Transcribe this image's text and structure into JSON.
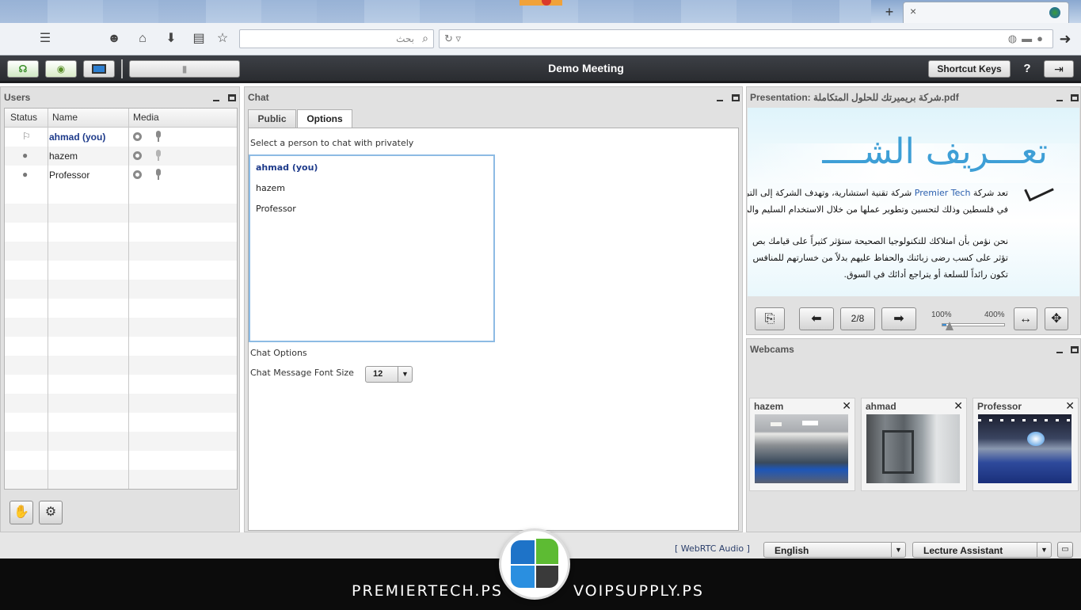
{
  "browser": {
    "new_tab_label": "+",
    "close_tab_label": "×",
    "search_placeholder": "بحث"
  },
  "toolbar": {
    "meeting_title": "Demo Meeting",
    "shortcut_keys_label": "Shortcut Keys",
    "help_label": "?"
  },
  "users_panel": {
    "title": "Users",
    "columns": [
      "Status",
      "Name",
      "Media"
    ],
    "users": [
      {
        "name": "ahmad (you)",
        "is_self": true,
        "role": "presenter",
        "mic_muted": false
      },
      {
        "name": "hazem",
        "is_self": false,
        "role": "viewer",
        "mic_muted": true
      },
      {
        "name": "Professor",
        "is_self": false,
        "role": "viewer",
        "mic_muted": false
      }
    ]
  },
  "chat_panel": {
    "title": "Chat",
    "tabs": [
      "Public",
      "Options"
    ],
    "active_tab": "Options",
    "private_prompt": "Select a person to chat with privately",
    "people": [
      "ahmad (you)",
      "hazem",
      "Professor"
    ],
    "options_heading": "Chat Options",
    "font_size_label": "Chat Message Font Size",
    "font_size_value": "12"
  },
  "presentation_panel": {
    "title": "Presentation: شركة بريميرتك للحلول المتكاملة.pdf",
    "slide": {
      "heading": "تعـــريف الشــــ",
      "line1_pre": "تعد شركة ",
      "line1_brand": "Premier Tech",
      "line1_post": " شركة تقنية استشارية، وتهدف الشركة إلى التر",
      "line2": "في فلسطين وذلك لتحسين وتطوير عملها من خلال الاستخدام السليم والمنا",
      "line3": "نحن نؤمن بأن امتلاكك للتكنولوجيا الصحيحة ستؤثر كثيراً على قيامك بص",
      "line4": "تؤثر على كسب رضى زبائنك والحفاظ عليهم بدلاً من خسارتهم للمنافس",
      "line5": "تكون رائداً للسلعة أو يتراجع أدائك في السوق."
    },
    "page_indicator": "2/8",
    "zoom_min_label": "100%",
    "zoom_max_label": "400%",
    "zoom_level": 0.06
  },
  "webcams_panel": {
    "title": "Webcams",
    "cams": [
      {
        "name": "hazem"
      },
      {
        "name": "ahmad"
      },
      {
        "name": "Professor"
      }
    ]
  },
  "status_bar": {
    "webrtc_label": "[ WebRTC Audio ]",
    "language_value": "English",
    "layout_value": "Lecture Assistant"
  },
  "footer": {
    "left_text": "PREMIERTECH.PS",
    "right_text": "VOIPSUPPLY.PS"
  },
  "colors": {
    "toolbar_bg": "#2f3136",
    "self_user": "#1d3a8a",
    "selection_border": "#8dbbe4",
    "slide_heading": "#3e9fd6"
  }
}
